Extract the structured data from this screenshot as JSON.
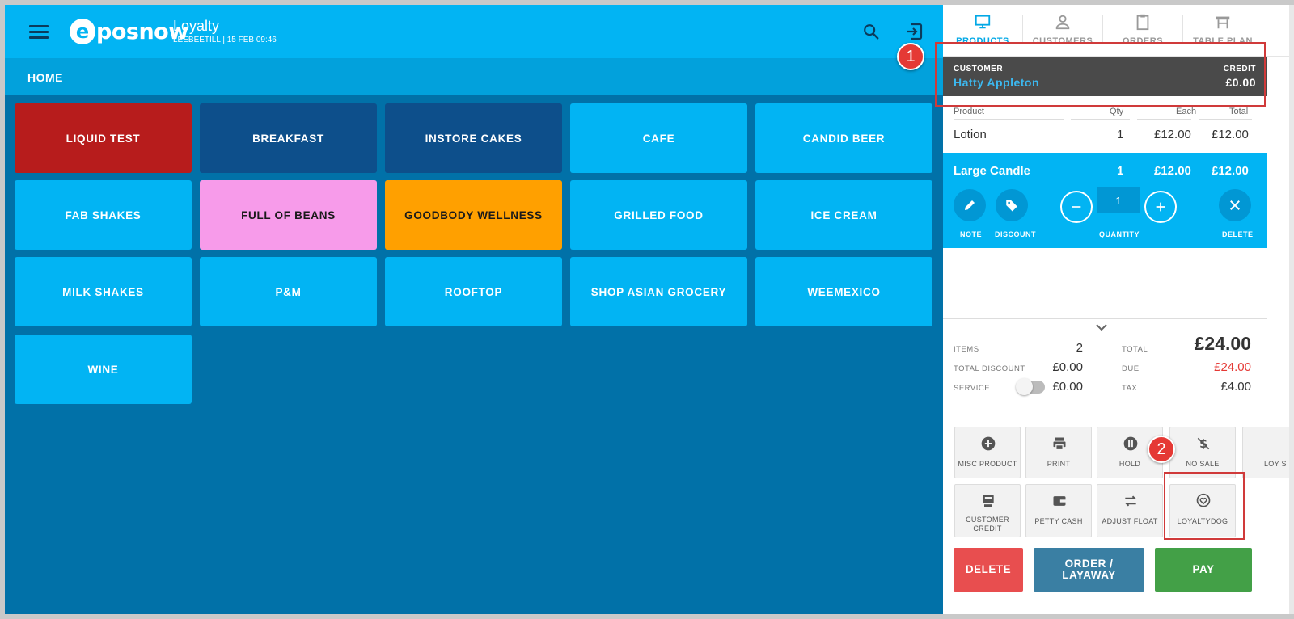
{
  "header": {
    "logo_text": "posnow",
    "logo_letter": "e",
    "title": "Loyalty",
    "subtitle": "LEEBEETILL | 15 FEB 09:46"
  },
  "home_label": "HOME",
  "categories": [
    {
      "label": "LIQUID TEST",
      "color": "#b71c1c",
      "text_color": "#ffffff"
    },
    {
      "label": "BREAKFAST",
      "color": "#0d4f8b",
      "text_color": "#ffffff"
    },
    {
      "label": "INSTORE CAKES",
      "color": "#0d4f8b",
      "text_color": "#ffffff"
    },
    {
      "label": "CAFE",
      "color": "#02b4f3",
      "text_color": "#ffffff"
    },
    {
      "label": "CANDID BEER",
      "color": "#02b4f3",
      "text_color": "#ffffff"
    },
    {
      "label": "FAB SHAKES",
      "color": "#02b4f3",
      "text_color": "#ffffff"
    },
    {
      "label": "FULL OF BEANS",
      "color": "#f79bea",
      "text_color": "#1a1a1a"
    },
    {
      "label": "GOODBODY WELLNESS",
      "color": "#ffa000",
      "text_color": "#1a1a1a"
    },
    {
      "label": "GRILLED FOOD",
      "color": "#02b4f3",
      "text_color": "#ffffff"
    },
    {
      "label": "ICE CREAM",
      "color": "#02b4f3",
      "text_color": "#ffffff"
    },
    {
      "label": "MILK SHAKES",
      "color": "#02b4f3",
      "text_color": "#ffffff"
    },
    {
      "label": "P&M",
      "color": "#02b4f3",
      "text_color": "#ffffff"
    },
    {
      "label": "ROOFTOP",
      "color": "#02b4f3",
      "text_color": "#ffffff"
    },
    {
      "label": "SHOP ASIAN GROCERY",
      "color": "#02b4f3",
      "text_color": "#ffffff"
    },
    {
      "label": "WEEMEXICO",
      "color": "#02b4f3",
      "text_color": "#ffffff"
    },
    {
      "label": "WINE",
      "color": "#02b4f3",
      "text_color": "#ffffff"
    }
  ],
  "nav_tabs": [
    "PRODUCTS",
    "CUSTOMERS",
    "ORDERS",
    "TABLE PLAN"
  ],
  "customer": {
    "label": "CUSTOMER",
    "name": "Hatty Appleton",
    "credit_label": "CREDIT",
    "credit_value": "£0.00"
  },
  "order_columns": {
    "product": "Product",
    "qty": "Qty",
    "each": "Each",
    "total": "Total"
  },
  "order_lines": [
    {
      "product": "Lotion",
      "qty": "1",
      "each": "£12.00",
      "total": "£12.00"
    },
    {
      "product": "Large Candle",
      "qty": "1",
      "each": "£12.00",
      "total": "£12.00"
    }
  ],
  "line_actions": {
    "note": "NOTE",
    "discount": "DISCOUNT",
    "quantity": "QUANTITY",
    "quantity_value": "1",
    "delete": "DELETE"
  },
  "totals": {
    "items_label": "ITEMS",
    "items_value": "2",
    "total_discount_label": "TOTAL DISCOUNT",
    "total_discount_value": "£0.00",
    "service_label": "SERVICE",
    "service_value": "£0.00",
    "total_label": "TOTAL",
    "total_value": "£24.00",
    "due_label": "DUE",
    "due_value": "£24.00",
    "tax_label": "TAX",
    "tax_value": "£4.00"
  },
  "function_buttons": {
    "misc_product": "MISC PRODUCT",
    "print": "PRINT",
    "hold": "HOLD",
    "no_sale": "NO SALE",
    "loyalty_partial": "LOY S",
    "customer_credit_1": "CUSTOMER",
    "customer_credit_2": "CREDIT",
    "petty_cash": "PETTY CASH",
    "adjust_float": "ADJUST FLOAT",
    "loyaltydog": "LOYALTYDOG"
  },
  "actions": {
    "delete": "DELETE",
    "order_layaway_1": "ORDER /",
    "order_layaway_2": "LAYAWAY",
    "pay": "PAY"
  },
  "annotations": {
    "badge1": "1",
    "badge2": "2"
  },
  "colors": {
    "brand_blue": "#02b4f3",
    "dark_blue": "#0171a8",
    "due_red": "#e53935",
    "pay_green": "#43a047",
    "delete_red": "#e84e4f",
    "layaway_blue": "#3a7fa3"
  }
}
